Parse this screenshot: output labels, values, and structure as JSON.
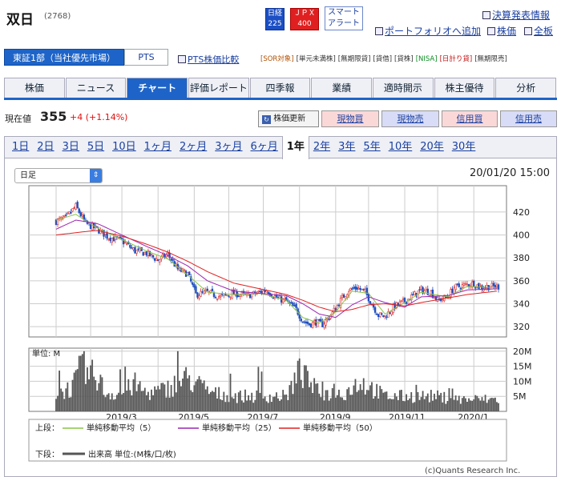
{
  "header": {
    "name": "双日",
    "code": "(2768)",
    "index_badges": [
      {
        "top": "日経",
        "bottom": "225"
      },
      {
        "top": "ＪＰＸ",
        "bottom": "400"
      }
    ],
    "smart_alert": [
      "スマート",
      "アラート"
    ],
    "links": {
      "earnings": "決算発表情報",
      "portfolio": "ポートフォリオへ追加",
      "stock_price": "株価",
      "full_board": "全板"
    }
  },
  "market": {
    "label": "東証1部（当社優先市場）",
    "pts": "PTS",
    "pts_compare": "PTS株価比較",
    "badges": [
      "[SOR対象]",
      "[単元未満株]",
      "[無期限貸]",
      "[貸借]",
      "[貸株]",
      "[NISA]",
      "[日計り貸]",
      "[無期限売]"
    ]
  },
  "nav": [
    "株価",
    "ニュース",
    "チャート",
    "評価レポート",
    "四季報",
    "業績",
    "適時開示",
    "株主優待",
    "分析"
  ],
  "nav_active": 2,
  "quote": {
    "label": "現在値",
    "price": "355",
    "change": "+4 (+1.14%)",
    "refresh": "株価更新",
    "actions": [
      "現物買",
      "現物売",
      "信用買",
      "信用売"
    ]
  },
  "periods": [
    "1日",
    "2日",
    "3日",
    "5日",
    "10日",
    "1ヶ月",
    "2ヶ月",
    "3ヶ月",
    "6ヶ月",
    "1年",
    "2年",
    "3年",
    "5年",
    "10年",
    "20年",
    "30年"
  ],
  "period_active": 9,
  "chart_controls": {
    "select": "日足",
    "timestamp": "20/01/20 15:00"
  },
  "chart_data": {
    "type": "candlestick",
    "x_labels": [
      "2019/3",
      "2019/5",
      "2019/7",
      "2019/9",
      "2019/11",
      "2020/1"
    ],
    "price_ticks": [
      320,
      340,
      360,
      380,
      400,
      420
    ],
    "ylim": [
      311,
      443
    ],
    "volume_unit": "単位: M",
    "volume_ticks": [
      "5M",
      "10M",
      "15M",
      "20M"
    ],
    "volume_ylim": [
      0,
      21
    ],
    "close_path": [
      [
        0,
        412
      ],
      [
        6,
        415
      ],
      [
        12,
        425
      ],
      [
        18,
        410
      ],
      [
        25,
        405
      ],
      [
        32,
        398
      ],
      [
        40,
        395
      ],
      [
        48,
        386
      ],
      [
        55,
        384
      ],
      [
        62,
        378
      ],
      [
        68,
        383
      ],
      [
        74,
        370
      ],
      [
        80,
        366
      ],
      [
        85,
        348
      ],
      [
        92,
        350
      ],
      [
        100,
        346
      ],
      [
        108,
        349
      ],
      [
        116,
        347
      ],
      [
        124,
        350
      ],
      [
        128,
        352
      ],
      [
        134,
        345
      ],
      [
        140,
        342
      ],
      [
        146,
        335
      ],
      [
        150,
        325
      ],
      [
        154,
        322
      ],
      [
        158,
        324
      ],
      [
        162,
        322
      ],
      [
        166,
        328
      ],
      [
        170,
        336
      ],
      [
        174,
        345
      ],
      [
        178,
        352
      ],
      [
        183,
        354
      ],
      [
        188,
        350
      ],
      [
        192,
        340
      ],
      [
        196,
        330
      ],
      [
        200,
        329
      ],
      [
        206,
        338
      ],
      [
        212,
        342
      ],
      [
        218,
        348
      ],
      [
        222,
        352
      ],
      [
        228,
        350
      ],
      [
        232,
        343
      ],
      [
        238,
        346
      ],
      [
        242,
        354
      ],
      [
        248,
        356
      ],
      [
        254,
        358
      ],
      [
        258,
        354
      ],
      [
        262,
        355
      ],
      [
        268,
        355
      ]
    ],
    "ma_lines": [
      {
        "name": "単純移動平均（5）",
        "color": "#8bc34a",
        "points": [
          [
            0,
            413
          ],
          [
            12,
            418
          ],
          [
            25,
            406
          ],
          [
            40,
            396
          ],
          [
            55,
            386
          ],
          [
            68,
            379
          ],
          [
            80,
            365
          ],
          [
            92,
            350
          ],
          [
            108,
            348
          ],
          [
            124,
            349
          ],
          [
            140,
            343
          ],
          [
            150,
            328
          ],
          [
            160,
            323
          ],
          [
            170,
            333
          ],
          [
            180,
            351
          ],
          [
            190,
            349
          ],
          [
            200,
            331
          ],
          [
            212,
            341
          ],
          [
            222,
            350
          ],
          [
            238,
            346
          ],
          [
            250,
            355
          ],
          [
            268,
            354
          ]
        ]
      },
      {
        "name": "単純移動平均（25）",
        "color": "#9c27b0",
        "points": [
          [
            0,
            405
          ],
          [
            12,
            413
          ],
          [
            25,
            410
          ],
          [
            40,
            400
          ],
          [
            55,
            390
          ],
          [
            68,
            382
          ],
          [
            80,
            373
          ],
          [
            92,
            360
          ],
          [
            108,
            351
          ],
          [
            124,
            349
          ],
          [
            140,
            347
          ],
          [
            150,
            340
          ],
          [
            160,
            331
          ],
          [
            170,
            328
          ],
          [
            180,
            339
          ],
          [
            190,
            346
          ],
          [
            200,
            341
          ],
          [
            212,
            337
          ],
          [
            222,
            346
          ],
          [
            238,
            347
          ],
          [
            250,
            352
          ],
          [
            268,
            353
          ]
        ]
      },
      {
        "name": "単純移動平均（50）",
        "color": "#e02020",
        "points": [
          [
            0,
            400
          ],
          [
            12,
            402
          ],
          [
            25,
            404
          ],
          [
            40,
            399
          ],
          [
            55,
            392
          ],
          [
            68,
            385
          ],
          [
            80,
            377
          ],
          [
            92,
            368
          ],
          [
            108,
            358
          ],
          [
            124,
            353
          ],
          [
            140,
            348
          ],
          [
            150,
            343
          ],
          [
            160,
            337
          ],
          [
            170,
            333
          ],
          [
            180,
            335
          ],
          [
            190,
            339
          ],
          [
            200,
            340
          ],
          [
            212,
            338
          ],
          [
            222,
            341
          ],
          [
            238,
            345
          ],
          [
            250,
            348
          ],
          [
            268,
            351
          ]
        ]
      }
    ],
    "volume_path": [
      [
        0,
        6
      ],
      [
        10,
        8
      ],
      [
        15,
        14
      ],
      [
        18,
        12
      ],
      [
        25,
        12
      ],
      [
        30,
        6
      ],
      [
        40,
        6
      ],
      [
        48,
        9
      ],
      [
        55,
        6
      ],
      [
        65,
        7
      ],
      [
        80,
        11
      ],
      [
        95,
        6
      ],
      [
        110,
        5
      ],
      [
        125,
        5
      ],
      [
        140,
        5
      ],
      [
        148,
        13
      ],
      [
        160,
        6
      ],
      [
        175,
        6
      ],
      [
        185,
        10
      ],
      [
        200,
        5
      ],
      [
        215,
        5
      ],
      [
        230,
        5
      ],
      [
        245,
        4
      ],
      [
        260,
        4
      ],
      [
        268,
        4
      ]
    ],
    "legend_upper_label": "上段：",
    "legend_lower_label": "下段：",
    "legend_volume": "出来高 単位:(M株/口/枚)"
  },
  "copyright": "(c)Quants Research Inc."
}
